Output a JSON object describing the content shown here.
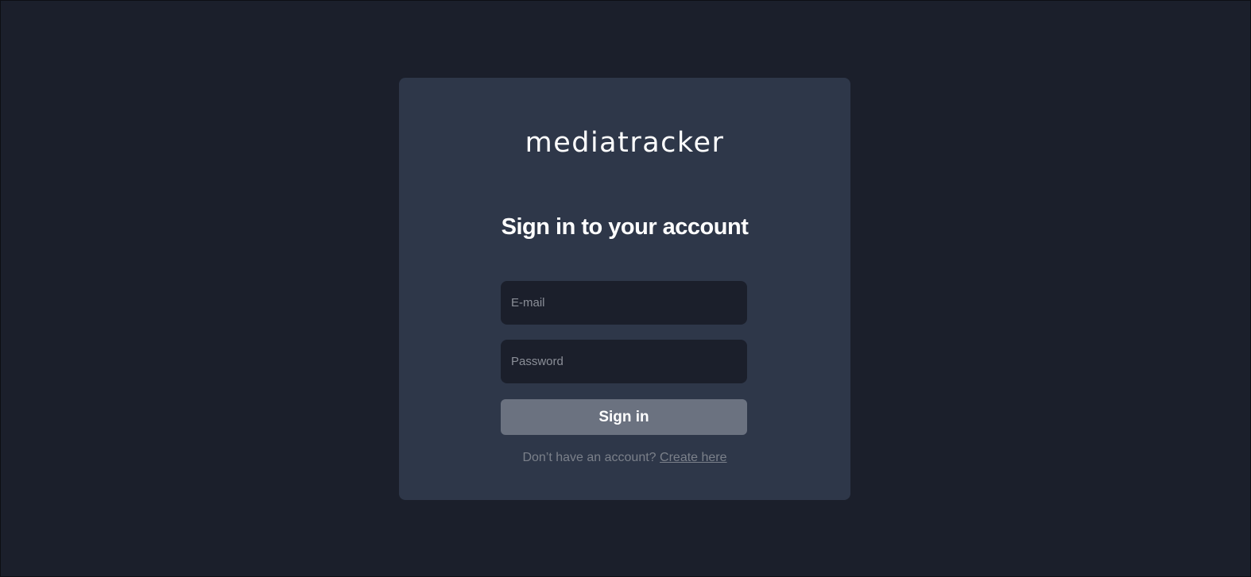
{
  "app": {
    "logo_text": "mediatracker"
  },
  "login": {
    "heading": "Sign in to your account",
    "email_placeholder": "E-mail",
    "email_value": "",
    "password_placeholder": "Password",
    "password_value": "",
    "submit_label": "Sign in",
    "signup_prompt": "Don’t have an account?",
    "signup_link": "Create here"
  },
  "colors": {
    "page_background": "#1b1f2b",
    "card_background": "#2e3749",
    "input_background": "#1b1f2b",
    "button_background": "#6b7280",
    "muted_text": "#7b808a"
  }
}
